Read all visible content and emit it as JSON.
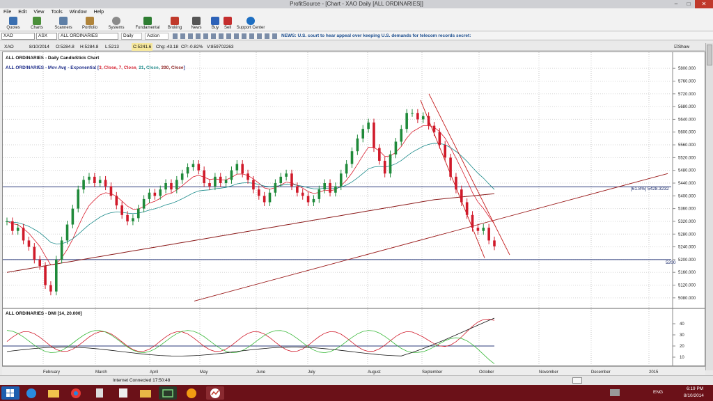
{
  "window": {
    "title": "ProfitSource - [Chart - XAO Daily [ALL ORDINARIES]]"
  },
  "menu": [
    "File",
    "Edit",
    "View",
    "Tools",
    "Window",
    "Help"
  ],
  "toolbar": [
    "Quotes",
    "Charts",
    "Scanners",
    "Portfolio",
    "Systems",
    "Fundamental",
    "Broking",
    "News",
    "Buy",
    "Sell",
    "Support Center"
  ],
  "secondary": {
    "symbol": "XAO",
    "exchange": "ASX",
    "name": "ALL ORDINARIES",
    "period": "Daily",
    "action": "Action",
    "news": "NEWS: U.S. court to hear appeal over keeping U.S. demands for telecom records secret:"
  },
  "info": {
    "symbol": "XAO",
    "date": "8/10/2014",
    "open": "O:5284.8",
    "high": "H:5284.8",
    "low": "L:5213",
    "close": "C:5241.6",
    "chg": "Chg:-43.18",
    "cp": "CP:-0.82%",
    "vol": "V:859702263",
    "show_last": "Show Last"
  },
  "chart": {
    "title1": "ALL ORDINARIES - Daily CandleStick Chart",
    "ma_prefix": "ALL ORDINARIES - Mov Avg - Exponential",
    "ma_params": [
      {
        "text": "3, Close,",
        "color": "#d81b2b"
      },
      {
        "text": "7, Close,",
        "color": "#d81b2b"
      },
      {
        "text": "21, Close,",
        "color": "#1a8a8a"
      },
      {
        "text": "200, Close",
        "color": "#8b1a1a"
      }
    ],
    "fib_label": "[61.8%] 5428.3232",
    "support_label": "5200",
    "dmi_title": "ALL ORDINARIES - DMI [14, 20.000]"
  },
  "chart_data": {
    "type": "candlestick",
    "x_labels": [
      "February",
      "March",
      "April",
      "May",
      "June",
      "July",
      "August",
      "September",
      "October",
      "November",
      "December",
      "2015"
    ],
    "y_ticks": [
      5080,
      5120,
      5160,
      5200,
      5240,
      5280,
      5320,
      5360,
      5400,
      5440,
      5480,
      5520,
      5560,
      5600,
      5640,
      5680,
      5720,
      5760,
      5800
    ],
    "y_labels": [
      "5080.000",
      "5120.000",
      "5160.000",
      "5200.000",
      "5240.000",
      "5280.000",
      "5320.000",
      "5360.000",
      "5400.000",
      "5440.000",
      "5480.000",
      "5520.000",
      "5560.000",
      "5600.000",
      "5640.000",
      "5680.000",
      "5720.000",
      "5760.000",
      "5800.000"
    ],
    "ylim": [
      5060,
      5820
    ],
    "horizontal_lines": [
      5428.3232,
      5200
    ],
    "dmi_ticks": [
      "40",
      "30",
      "20",
      "10"
    ],
    "dmi_ylim": [
      5,
      45
    ],
    "dmi_level": 20,
    "close_series": [
      5320,
      5290,
      5300,
      5260,
      5240,
      5200,
      5180,
      5120,
      5100,
      5200,
      5260,
      5310,
      5360,
      5420,
      5450,
      5460,
      5440,
      5450,
      5430,
      5400,
      5370,
      5340,
      5320,
      5330,
      5360,
      5390,
      5410,
      5400,
      5420,
      5440,
      5420,
      5450,
      5470,
      5490,
      5500,
      5480,
      5440,
      5430,
      5460,
      5440,
      5450,
      5480,
      5500,
      5470,
      5450,
      5420,
      5400,
      5380,
      5410,
      5440,
      5460,
      5470,
      5430,
      5410,
      5400,
      5380,
      5390,
      5420,
      5440,
      5410,
      5430,
      5470,
      5500,
      5540,
      5580,
      5610,
      5630,
      5550,
      5510,
      5470,
      5530,
      5570,
      5610,
      5660,
      5660,
      5640,
      5650,
      5620,
      5600,
      5560,
      5520,
      5460,
      5420,
      5380,
      5340,
      5300,
      5290,
      5300,
      5260,
      5241.6
    ]
  },
  "status": {
    "connection": "Internet Connected 17:50:48"
  },
  "taskbar": {
    "time": "6:19 PM",
    "date": "8/10/2014",
    "lang": "ENG"
  }
}
